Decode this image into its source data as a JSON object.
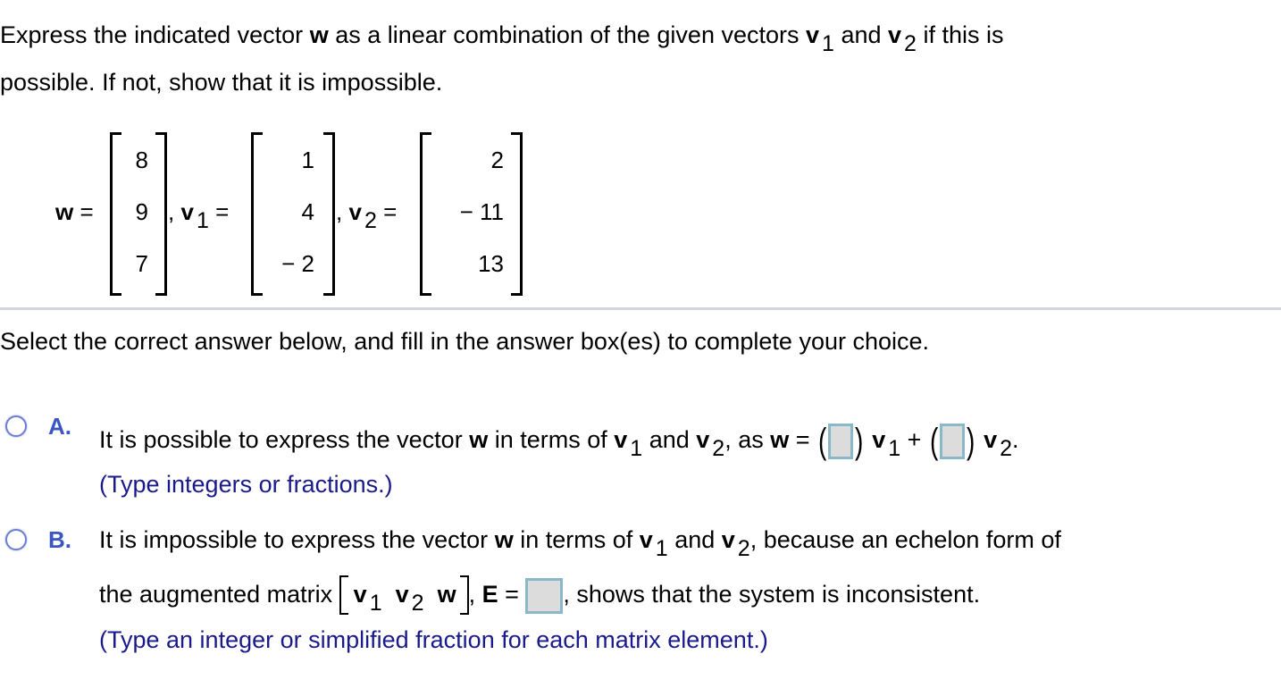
{
  "question": {
    "line1_a": "Express the indicated vector ",
    "w": "w",
    "line1_b": " as a linear combination of the given vectors ",
    "v": "v",
    "sub1": "1",
    "and": " and ",
    "sub2": "2",
    "line1_c": " if this is",
    "line2": "possible. If not, show that it is impossible."
  },
  "vectors": {
    "w_label": "w",
    "eq": "=",
    "comma": ",",
    "v1_label": "v",
    "v1_sub": "1",
    "v2_label": "v",
    "v2_sub": "2",
    "w_values": [
      "8",
      "9",
      "7"
    ],
    "v1_values": [
      "1",
      "4",
      "− 2"
    ],
    "v2_values": [
      "2",
      "− 11",
      "13"
    ]
  },
  "instruction": "Select the correct answer below, and fill in the answer box(es) to complete your choice.",
  "choices": {
    "a": {
      "letter": "A.",
      "text_a": "It is possible to express the vector ",
      "text_b": " in terms of ",
      "text_c": " and ",
      "text_d": ", as ",
      "text_e": " = ",
      "plus": " + ",
      "period": ".",
      "hint": "(Type integers or fractions.)",
      "box1_value": "",
      "box2_value": ""
    },
    "b": {
      "letter": "B.",
      "text_a": "It is impossible to express the vector ",
      "text_b": " in terms of ",
      "text_c": " and ",
      "text_d": ", because an echelon form of",
      "line2_a": "the augmented matrix ",
      "line2_b": ", ",
      "E": "E",
      "eq": " = ",
      "line2_c": ", shows that the system is inconsistent.",
      "hint": "(Type an integer or simplified fraction for each matrix element.)",
      "box_value": ""
    }
  },
  "colors": {
    "choice_letter": "#3b55c3",
    "hint_text": "#1a1a8c",
    "answer_box_border": "#8ab8c9",
    "answer_box_fill": "#dcdcdc",
    "divider": "#d2d6dc"
  }
}
